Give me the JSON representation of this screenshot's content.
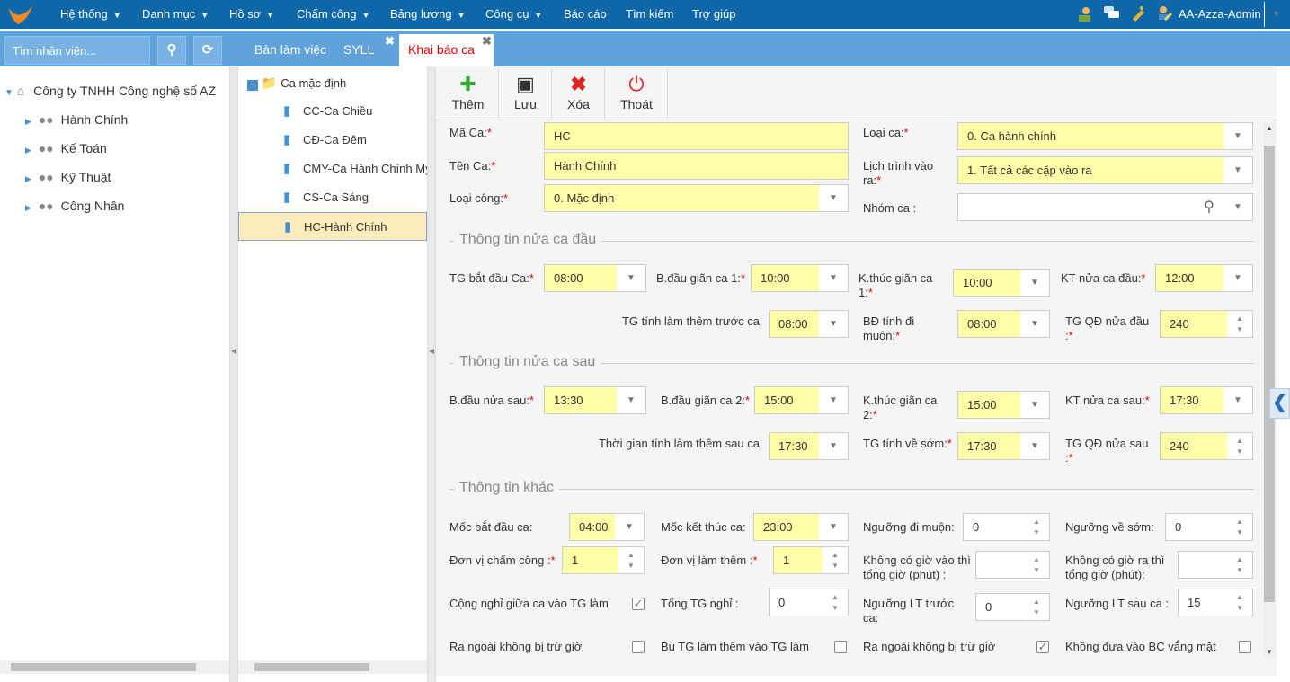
{
  "topbar": {
    "menus": [
      {
        "label": "Hệ thống",
        "dropdown": true
      },
      {
        "label": "Danh mục",
        "dropdown": true
      },
      {
        "label": "Hồ sơ",
        "dropdown": true
      },
      {
        "label": "Chấm công",
        "dropdown": true
      },
      {
        "label": "Bảng lương",
        "dropdown": true
      },
      {
        "label": "Công cụ",
        "dropdown": true
      },
      {
        "label": "Báo cáo",
        "dropdown": false
      },
      {
        "label": "Tìm kiếm",
        "dropdown": false
      },
      {
        "label": "Trợ giúp",
        "dropdown": false
      }
    ],
    "user": "AA-Azza-Admin",
    "icons": [
      "users-icon",
      "chat-icon",
      "bell-icon",
      "user-edit-icon"
    ],
    "colors": {
      "bar": "#0e67a9",
      "band": "#5fa2dc",
      "highlight": "#ffffaa"
    }
  },
  "left": {
    "search_placeholder": "Tìm nhân viên...",
    "root": "Công ty TNHH Công nghệ số AZ",
    "groups": [
      "Hành Chính",
      "Kế Toán",
      "Kỹ Thuật",
      "Công Nhân"
    ]
  },
  "tabs": [
    {
      "label": "Bàn làm việc"
    },
    {
      "label": "SYLL",
      "closable": true
    },
    {
      "label": "Khai báo ca",
      "closable": true,
      "active": true
    }
  ],
  "shift_tree": {
    "root": "Ca mặc định",
    "items": [
      "CC-Ca Chiều",
      "CĐ-Ca Đêm",
      "CMY-Ca Hành Chính My",
      "CS-Ca Sáng",
      "HC-Hành Chính"
    ],
    "selected": "HC-Hành Chính"
  },
  "toolbar": {
    "add": "Thêm",
    "save": "Lưu",
    "delete": "Xóa",
    "exit": "Thoát"
  },
  "sections": [
    "Thông tin nửa ca đầu",
    "Thông tin nửa ca sau",
    "Thông tin khác"
  ],
  "form": {
    "fields": [
      {
        "label": "Mã Ca:",
        "req": true,
        "value": "HC",
        "type": "text"
      },
      {
        "label": "Loại ca:",
        "req": true,
        "value": "0. Ca hành chính",
        "type": "select"
      },
      {
        "label": "Tên Ca:",
        "req": true,
        "value": "Hành Chính",
        "type": "text"
      },
      {
        "label": "Lịch trình vào ra:",
        "req": true,
        "value": "1. Tất cả các cặp vào ra",
        "type": "select"
      },
      {
        "label": "Loại công:",
        "req": true,
        "value": "0. Mặc định",
        "type": "select"
      },
      {
        "label": "Nhóm ca :",
        "req": false,
        "value": "",
        "type": "search-select"
      },
      {
        "label": "TG bắt đầu Ca:",
        "req": true,
        "value": "08:00",
        "type": "select"
      },
      {
        "label": "B.đầu giãn ca 1:",
        "req": true,
        "value": "10:00",
        "type": "select"
      },
      {
        "label": "K.thúc giãn ca 1:",
        "req": true,
        "value": "10:00",
        "type": "select"
      },
      {
        "label": "KT nửa ca đầu:",
        "req": true,
        "value": "12:00",
        "type": "select"
      },
      {
        "label": "TG tính làm thêm trước ca",
        "req": false,
        "value": "08:00",
        "type": "select"
      },
      {
        "label": "BĐ tính đi muộn:",
        "req": true,
        "value": "08:00",
        "type": "select"
      },
      {
        "label": "TG QĐ nửa đầu :",
        "req": true,
        "value": "240",
        "type": "spin"
      },
      {
        "label": "B.đầu nửa sau:",
        "req": true,
        "value": "13:30",
        "type": "select"
      },
      {
        "label": "B.đầu giãn ca 2:",
        "req": true,
        "value": "15:00",
        "type": "select"
      },
      {
        "label": "K.thúc giãn ca 2:",
        "req": true,
        "value": "15:00",
        "type": "select"
      },
      {
        "label": "KT nửa ca sau:",
        "req": true,
        "value": "17:30",
        "type": "select"
      },
      {
        "label": "Thời gian tính làm thêm sau ca",
        "req": false,
        "value": "17:30",
        "type": "select"
      },
      {
        "label": "TG tính về sớm:",
        "req": true,
        "value": "17:30",
        "type": "select"
      },
      {
        "label": "TG QĐ nửa sau :",
        "req": true,
        "value": "240",
        "type": "spin"
      },
      {
        "label": "Mốc bắt đầu ca:",
        "req": false,
        "value": "04:00",
        "type": "select"
      },
      {
        "label": "Mốc kết thúc ca:",
        "req": false,
        "value": "23:00",
        "type": "select"
      },
      {
        "label": "Ngưỡng đi muộn:",
        "req": false,
        "value": "0",
        "type": "spin-white"
      },
      {
        "label": "Ngưỡng về sớm:",
        "req": false,
        "value": "0",
        "type": "spin-white"
      },
      {
        "label": "Đơn vị chấm công :",
        "req": true,
        "value": "1",
        "type": "spin"
      },
      {
        "label": "Đơn vị làm thêm :",
        "req": true,
        "value": "1",
        "type": "spin"
      },
      {
        "label": "Không có giờ vào thì tổng giờ (phút) :",
        "req": false,
        "value": "",
        "type": "spin-white"
      },
      {
        "label": "Không có giờ ra thì tổng giờ (phút):",
        "req": false,
        "value": "",
        "type": "spin-white"
      },
      {
        "label": "Cộng nghỉ giữa ca vào TG làm",
        "req": false,
        "checked": true,
        "type": "check"
      },
      {
        "label": "Tổng TG nghỉ :",
        "req": false,
        "value": "0",
        "type": "spin-white"
      },
      {
        "label": "Ngưỡng LT trước ca:",
        "req": false,
        "value": "0",
        "type": "spin-white"
      },
      {
        "label": "Ngưỡng LT sau ca :",
        "req": false,
        "value": "15",
        "type": "spin-white"
      },
      {
        "label": "Ra ngoài không bị trừ giờ",
        "req": false,
        "checked": false,
        "type": "check"
      },
      {
        "label": "Bù TG làm thêm vào TG làm",
        "req": false,
        "checked": false,
        "type": "check"
      },
      {
        "label": "Ra ngoài không bị trừ giờ",
        "req": false,
        "checked": true,
        "type": "check"
      },
      {
        "label": "Không đưa vào BC vắng mặt",
        "req": false,
        "checked": false,
        "type": "check"
      }
    ]
  }
}
